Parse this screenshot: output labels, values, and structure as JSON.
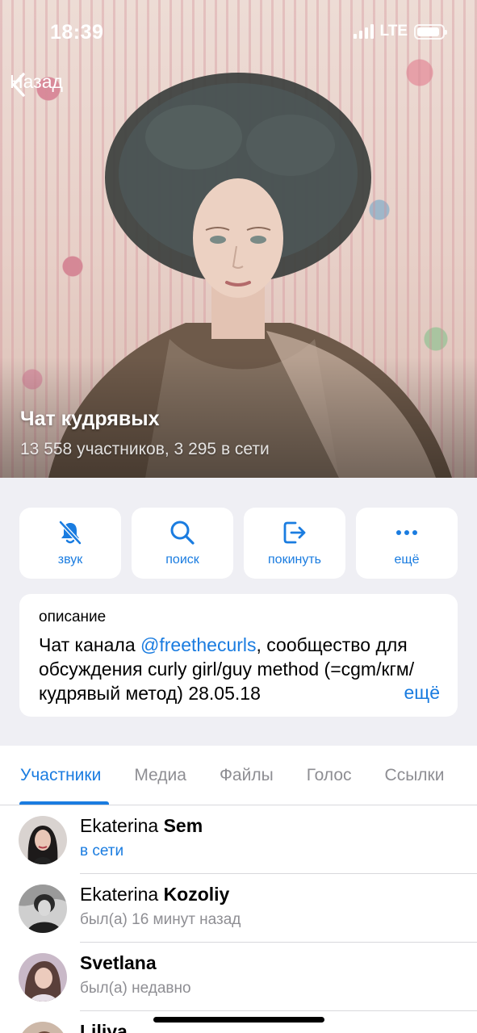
{
  "status_bar": {
    "time": "18:39",
    "network": "LTE",
    "battery_level": 0.9
  },
  "nav": {
    "back_label": "Назад"
  },
  "group": {
    "title": "Чат кудрявых",
    "subtitle": "13 558 участников, 3 295 в сети"
  },
  "actions": [
    {
      "label": "звук",
      "icon": "bell-slash-icon"
    },
    {
      "label": "поиск",
      "icon": "search-icon"
    },
    {
      "label": "покинуть",
      "icon": "leave-icon"
    },
    {
      "label": "ещё",
      "icon": "more-icon"
    }
  ],
  "description": {
    "label": "описание",
    "text_before": "Чат канала ",
    "link": "@freethecurls",
    "text_after": ", сообщество для обсуждения curly girl/guy method (=cgm/кгм/кудрявый метод) 28.05.18",
    "more": "ещё"
  },
  "tabs": [
    "Участники",
    "Медиа",
    "Файлы",
    "Голос",
    "Ссылки"
  ],
  "active_tab": "Участники",
  "members": [
    {
      "first": "Ekaterina",
      "last": "Sem",
      "status": "в сети",
      "online": true
    },
    {
      "first": "Ekaterina",
      "last": "Kozoliy",
      "status": "был(а) 16 минут назад",
      "online": false
    },
    {
      "first": "",
      "last": "Svetlana",
      "status": "был(а) недавно",
      "online": false
    },
    {
      "first": "",
      "last": "Liliya",
      "status": "",
      "online": false
    }
  ],
  "colors": {
    "accent": "#1a7ce0",
    "secondary_text": "#8e8e93",
    "background": "#efeff4"
  }
}
